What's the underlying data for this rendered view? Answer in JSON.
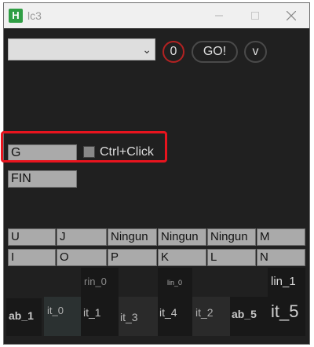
{
  "window": {
    "title": "lc3",
    "app_icon": "H"
  },
  "toolbar": {
    "combo_value": "",
    "counter": "0",
    "go_label": "GO!",
    "v_label": "v"
  },
  "fields": {
    "g_value": "G",
    "fin_value": "FIN"
  },
  "checkbox": {
    "label": "Ctrl+Click",
    "checked": false
  },
  "keys": {
    "row1": [
      "U",
      "J",
      "Ningun",
      "Ningun",
      "Ningun",
      "M"
    ],
    "row2": [
      "I",
      "O",
      "P",
      "K",
      "L",
      "N"
    ]
  },
  "tiles": {
    "rin_0": "rin_0",
    "lin_0": "lin_0",
    "lin_1": "lin_1",
    "ab_1": "ab_1",
    "it_0": "it_0",
    "it_1": "it_1",
    "it_3": "it_3",
    "it_4": "it_4",
    "it_2": "it_2",
    "ab_5": "ab_5",
    "it_5": "it_5"
  },
  "colors": {
    "highlight": "#e8141e",
    "counter_ring": "#b22222",
    "app_icon": "#2f9e44"
  }
}
